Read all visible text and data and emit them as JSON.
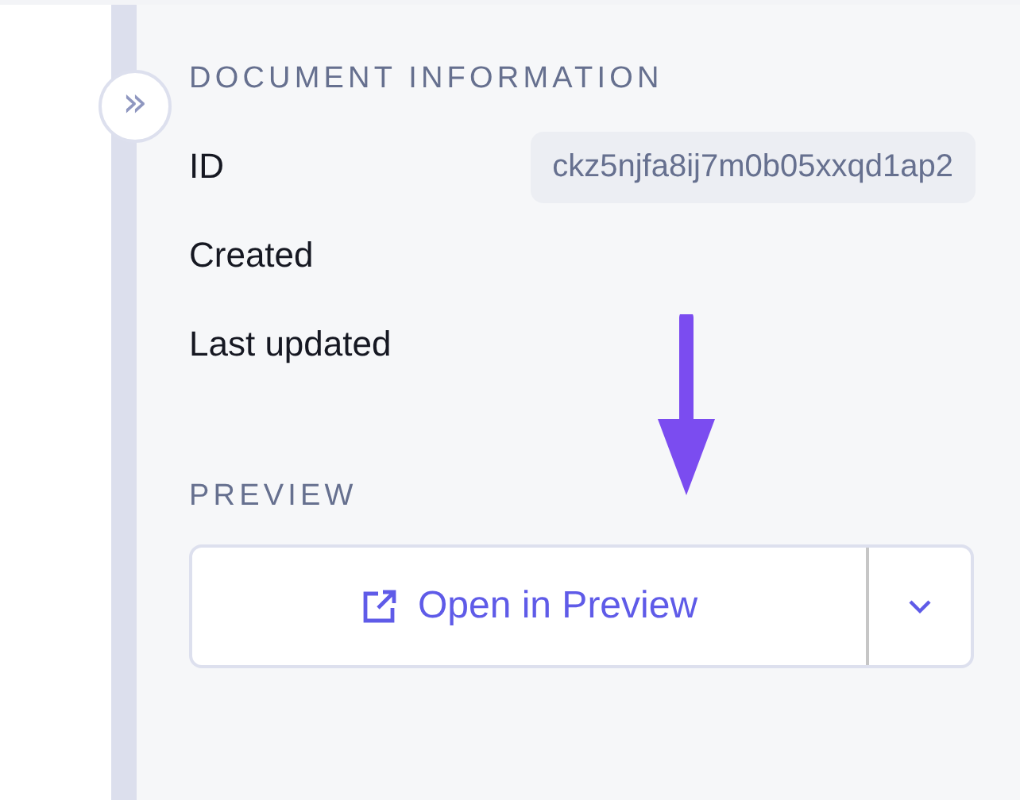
{
  "sidebar_toggle": {
    "icon": "»"
  },
  "document_information": {
    "heading": "DOCUMENT INFORMATION",
    "fields": [
      {
        "label": "ID",
        "value": "ckz5njfa8ij7m0b05xxqd1ap2"
      },
      {
        "label": "Created"
      },
      {
        "label": "Last updated"
      }
    ]
  },
  "preview": {
    "heading": "PREVIEW",
    "button": "Open in Preview"
  }
}
